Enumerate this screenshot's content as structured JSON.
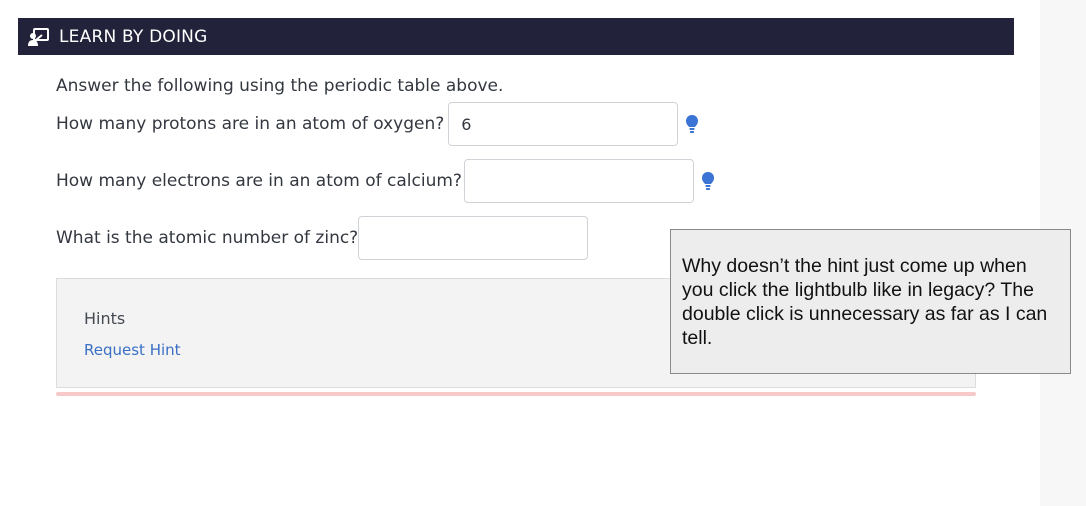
{
  "header": {
    "title": "LEARN BY DOING",
    "icon": "learn-by-doing-icon",
    "background": "#22233a"
  },
  "instruction": "Answer the following using the periodic table above.",
  "questions": [
    {
      "label": "How many protons are in an atom of oxygen?",
      "value": "6",
      "has_hint_icon": true
    },
    {
      "label": "How many electrons are in an atom of calcium?",
      "value": "",
      "has_hint_icon": true
    },
    {
      "label": "What is the atomic number of zinc?",
      "value": "",
      "has_hint_icon": false
    }
  ],
  "hints": {
    "title": "Hints",
    "request_label": "Request Hint",
    "link_color": "#3a6fc4"
  },
  "comment": {
    "text": "Why doesn’t the hint just come up when you click the lightbulb like in legacy? The double click is unnecessary as far as I can tell."
  },
  "colors": {
    "bulb": "#3b74d4",
    "pink_strip": "#f8c9c9"
  }
}
